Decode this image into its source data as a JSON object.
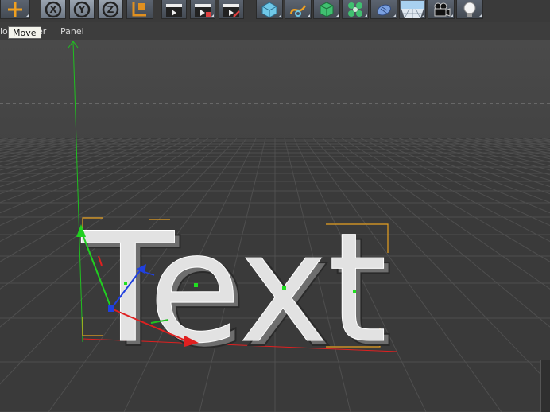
{
  "tooltip": {
    "text": "Move"
  },
  "menu": {
    "items": [
      {
        "label": "io"
      },
      {
        "label": "er"
      },
      {
        "label": "Panel"
      }
    ]
  },
  "toolbar": {
    "buttons": [
      {
        "icon": "move-icon"
      },
      {
        "icon": "x-axis-lock-icon",
        "label": "X"
      },
      {
        "icon": "y-axis-lock-icon",
        "label": "Y"
      },
      {
        "icon": "z-axis-lock-icon",
        "label": "Z"
      },
      {
        "icon": "coordinate-system-icon"
      },
      {
        "icon": "render-view-icon"
      },
      {
        "icon": "render-picture-viewer-icon"
      },
      {
        "icon": "edit-render-settings-icon"
      },
      {
        "icon": "cube-icon"
      },
      {
        "icon": "spline-pen-icon"
      },
      {
        "icon": "subdivision-surface-icon"
      },
      {
        "icon": "cloner-icon"
      },
      {
        "icon": "deformer-icon"
      },
      {
        "icon": "floor-icon"
      },
      {
        "icon": "camera-icon"
      },
      {
        "icon": "light-icon"
      }
    ]
  },
  "viewport": {
    "text_object": "Text",
    "colors": {
      "background": "#3a3a3a",
      "sky": "#484848",
      "x_axis": "#e02020",
      "y_axis": "#20c020",
      "z_axis": "#2040e0",
      "bbox": "#e8a020"
    }
  }
}
